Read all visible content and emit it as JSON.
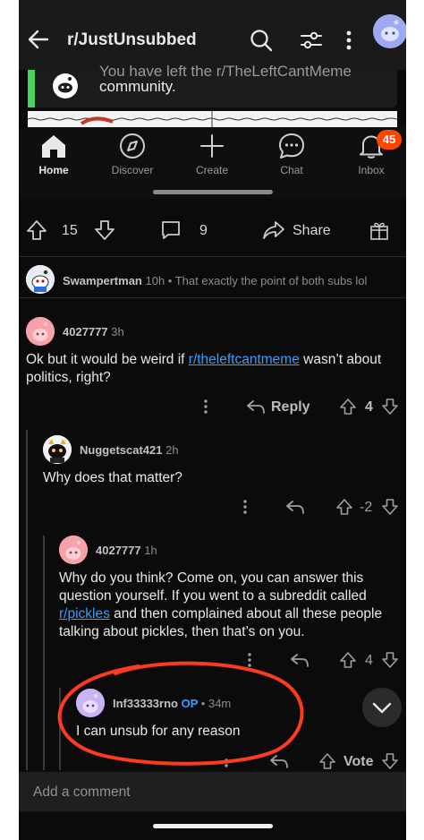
{
  "header": {
    "title": "r/JustUnsubbed"
  },
  "embedded": {
    "toast_cut_text": "You have left the r/TheLeftCantMeme",
    "toast_message": "community.",
    "nav": [
      {
        "label": "Home",
        "icon": "home-icon",
        "active": true
      },
      {
        "label": "Discover",
        "icon": "compass-icon"
      },
      {
        "label": "Create",
        "icon": "plus-icon"
      },
      {
        "label": "Chat",
        "icon": "chat-icon"
      },
      {
        "label": "Inbox",
        "icon": "bell-icon"
      }
    ],
    "inbox_badge": "45"
  },
  "post_actions": {
    "upvotes": "15",
    "comments": "9",
    "share_label": "Share"
  },
  "comments": [
    {
      "author": "Swampertman",
      "meta": "10h • That exactly the point of both subs lol",
      "collapsed": true
    },
    {
      "author": "4027777",
      "time": "3h",
      "body_before": "Ok but it would be weird if ",
      "body_link": "r/theleftcantmeme",
      "body_after": " wasn’t about politics, right?",
      "reply_label": "Reply",
      "score": "4"
    },
    {
      "author": "Nuggetscat421",
      "time": "2h",
      "body": "Why does that matter?",
      "score": "-2"
    },
    {
      "author": "4027777",
      "time": "1h",
      "body_before": "Why do you think? Come on, you can answer this question yourself. If you went to a subreddit called ",
      "body_link": "r/pickles",
      "body_after": " and then complained about all these people talking about pickles, then that’s on you.",
      "score": "4"
    },
    {
      "author": "Inf33333rno",
      "op_tag": "OP",
      "time": "• 34m",
      "body": "I can unsub for any reason",
      "vote_label": "Vote"
    }
  ],
  "composer": {
    "placeholder": "Add a comment"
  },
  "colors": {
    "accent_orange": "#ff4500",
    "link_blue": "#3a9dff",
    "annotation_red": "#ff3b1f"
  }
}
